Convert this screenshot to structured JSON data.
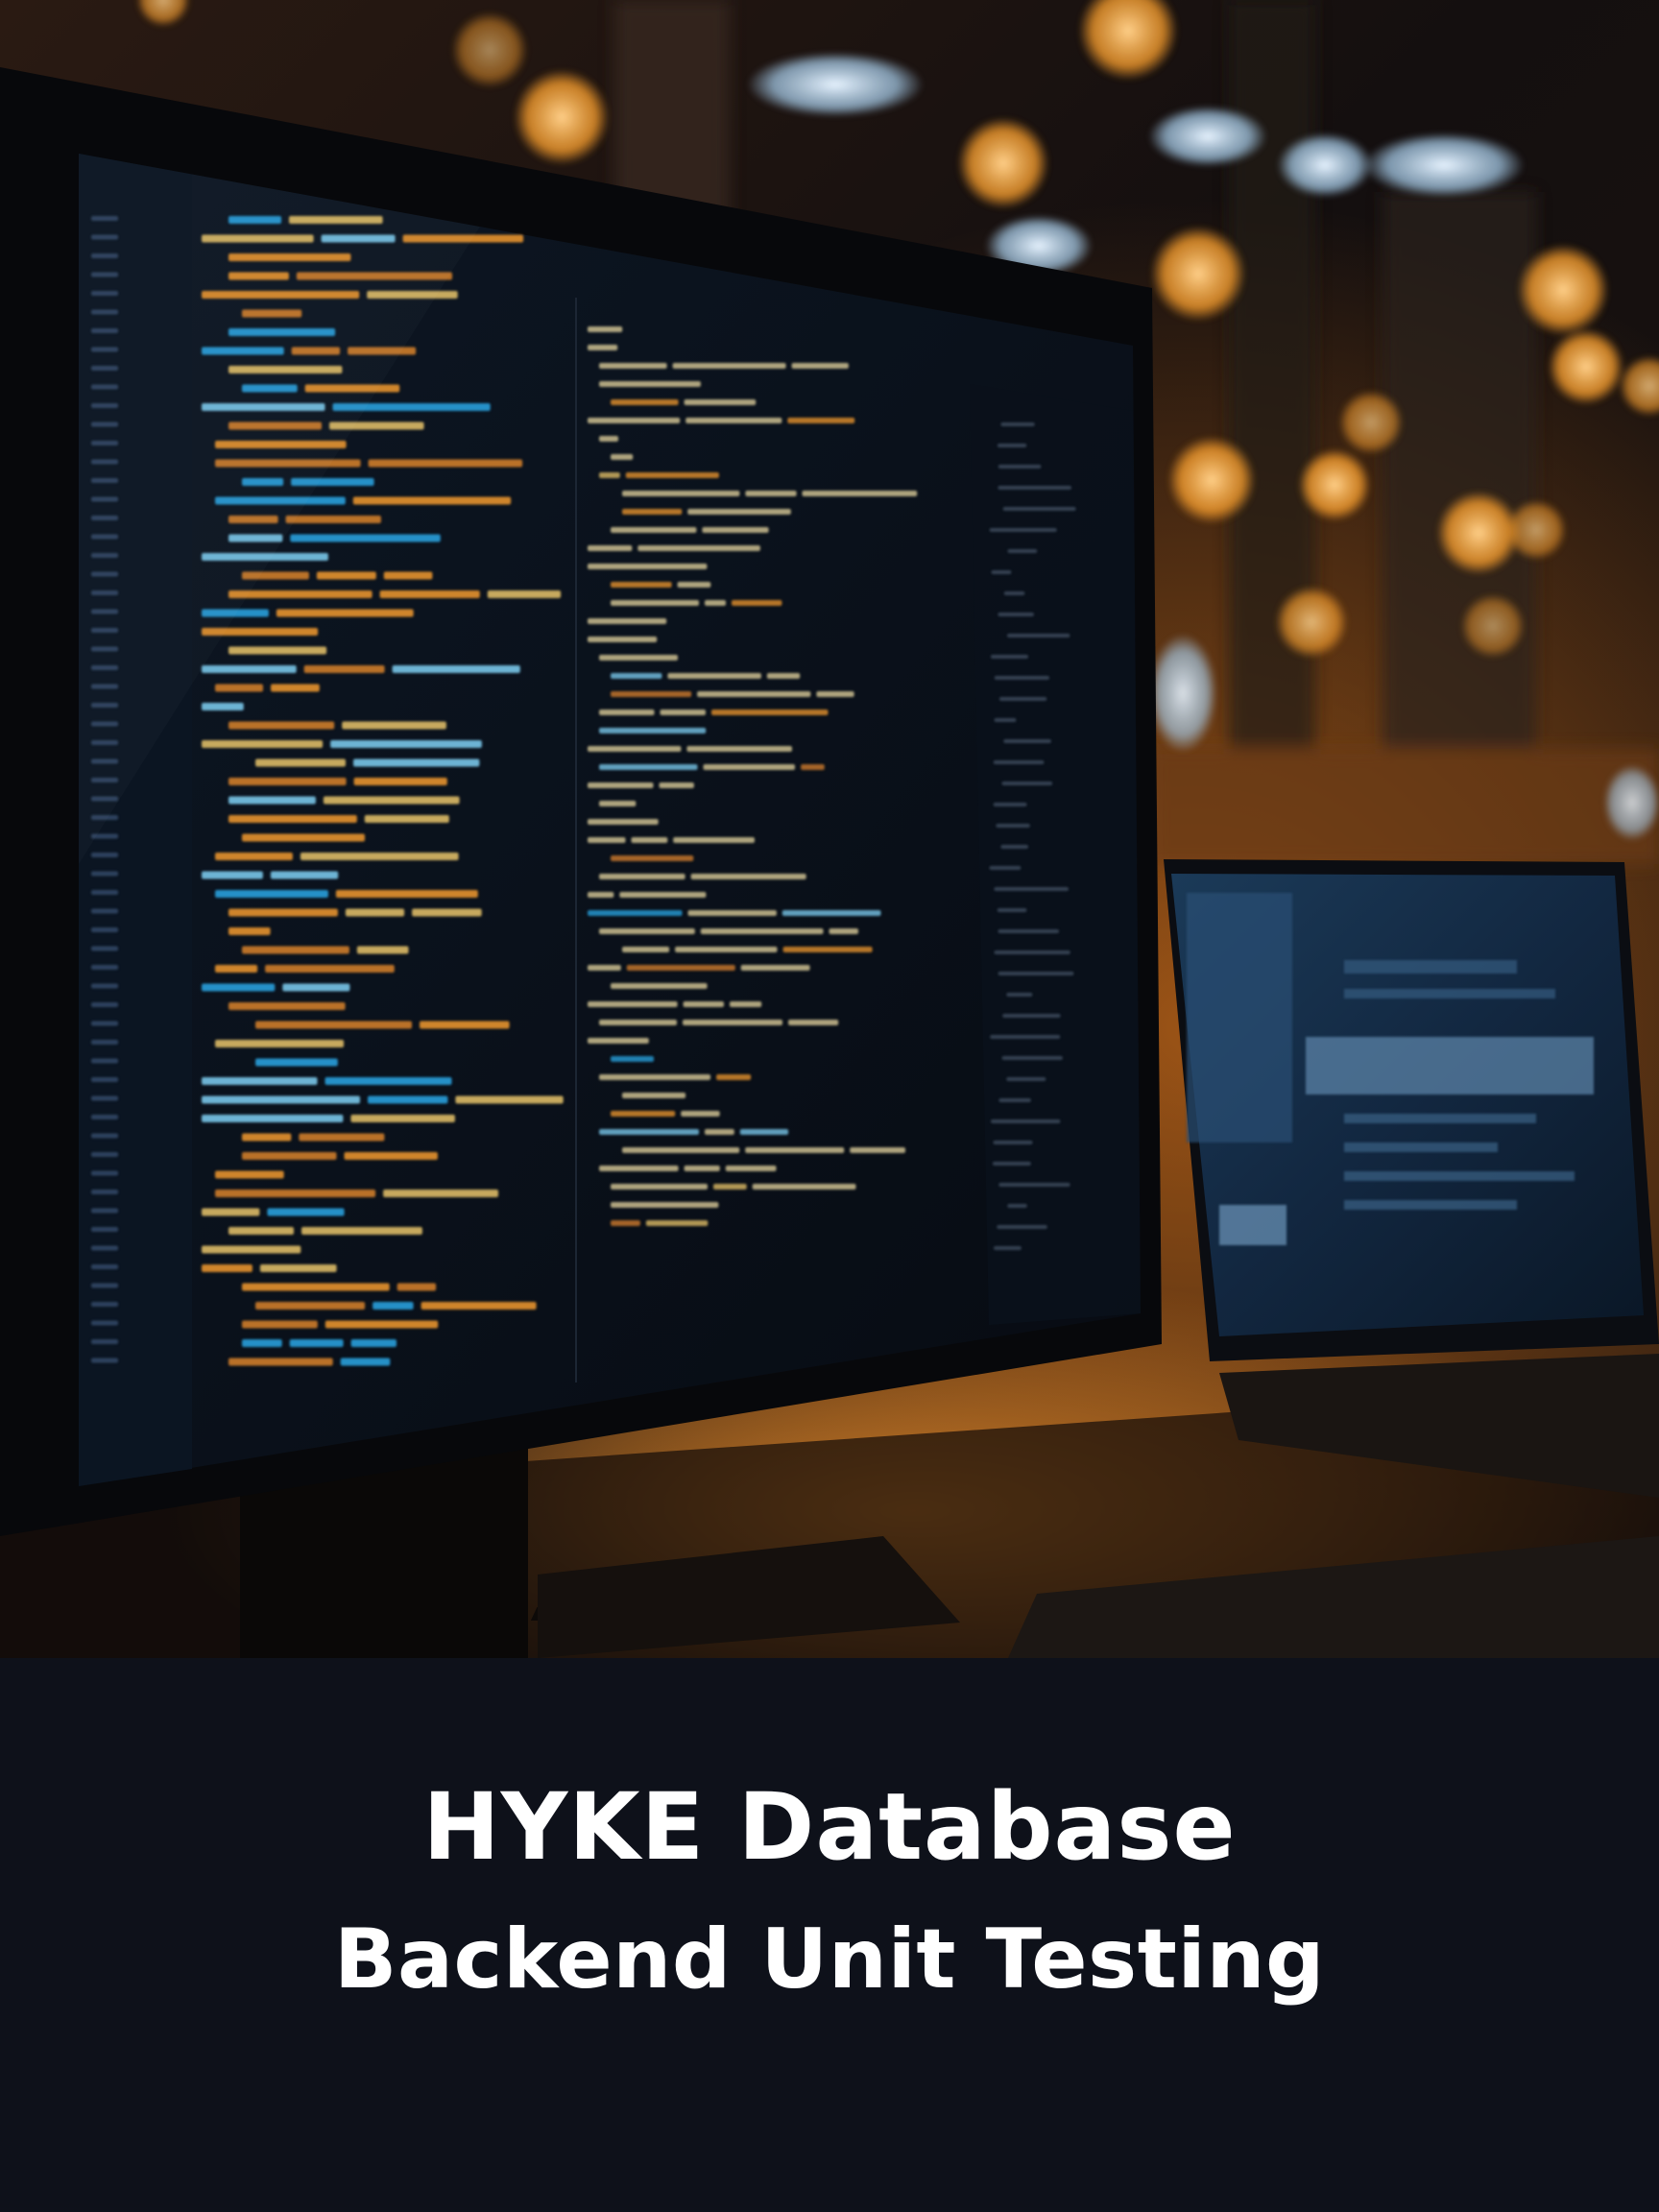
{
  "caption": {
    "title": "HYKE Database",
    "subtitle": "Backend Unit Testing"
  },
  "colors": {
    "background": "#0e111a",
    "text": "#ffffff",
    "code_orange": "#f29a2e",
    "code_blue": "#2aa7e6",
    "bokeh_amber": "#ffb347"
  },
  "photo": {
    "subject": "desktop monitor displaying source code with a laptop in the background and warm bokeh lights"
  }
}
